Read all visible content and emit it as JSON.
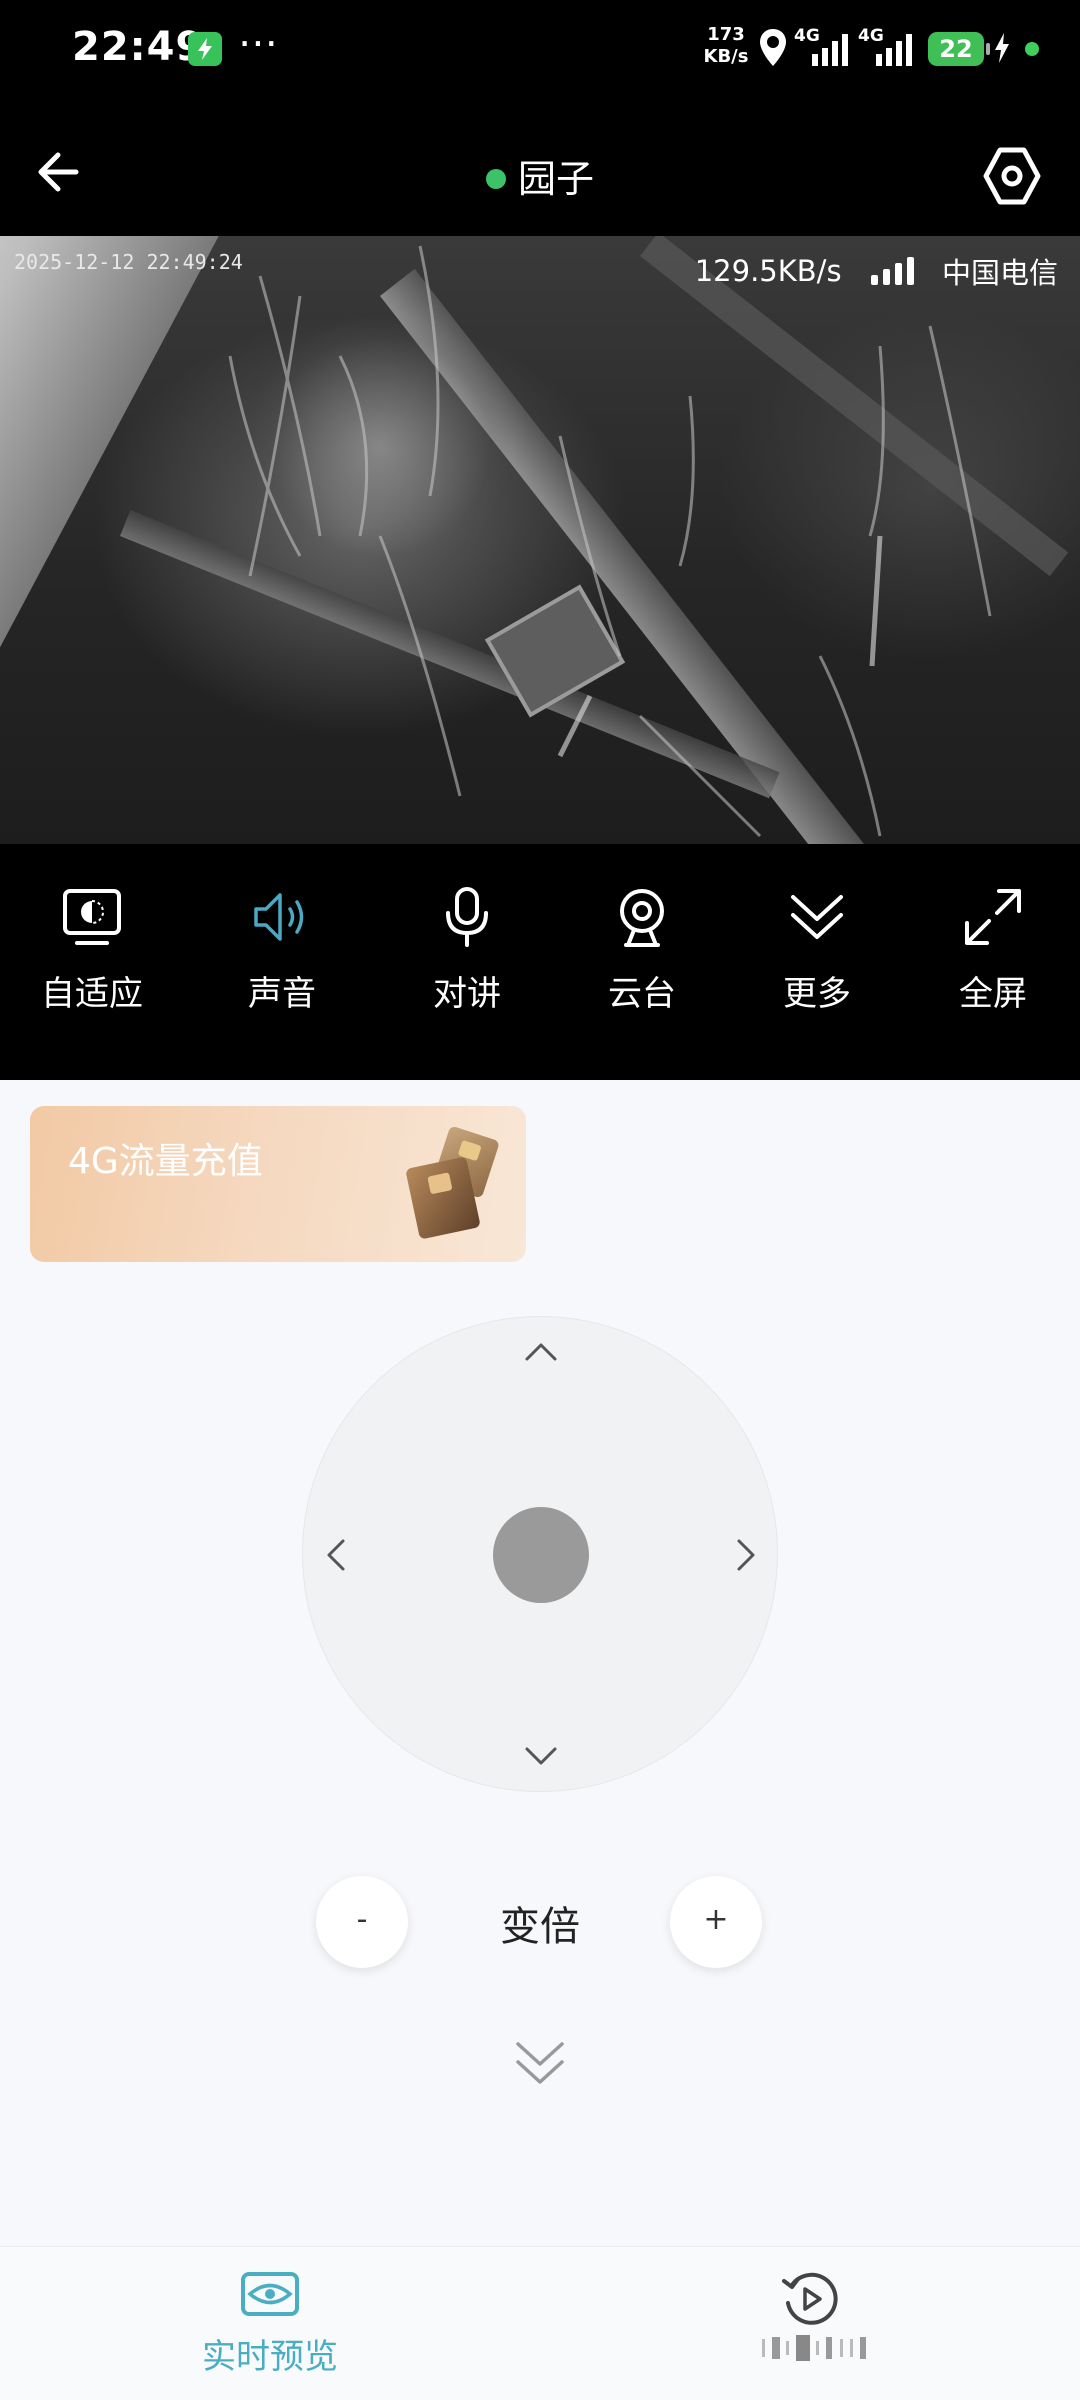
{
  "status_bar": {
    "time": "22:49",
    "net_speed_value": "173",
    "net_speed_unit": "KB/s",
    "network_1": "4G",
    "network_2": "4G",
    "battery": "22",
    "icons": [
      "charging-notification-icon",
      "more-dots-icon",
      "location-icon",
      "signal-icon",
      "battery-icon",
      "charging-icon"
    ]
  },
  "header": {
    "title": "园子",
    "status_color": "#3cc36a",
    "icons": [
      "back-arrow-icon",
      "settings-hex-icon"
    ]
  },
  "video": {
    "timestamp": "2025-12-12 22:49:24",
    "bitrate": "129.5KB/s",
    "carrier": "中国电信"
  },
  "controls": {
    "items": [
      {
        "label": "自适应",
        "icon": "adaptive-screen-icon"
      },
      {
        "label": "声音",
        "icon": "speaker-icon",
        "active": true
      },
      {
        "label": "对讲",
        "icon": "microphone-icon"
      },
      {
        "label": "云台",
        "icon": "ptz-camera-icon"
      },
      {
        "label": "更多",
        "icon": "double-chevron-down-icon"
      },
      {
        "label": "全屏",
        "icon": "fullscreen-icon"
      }
    ],
    "active_color": "#4aa9c4"
  },
  "promo": {
    "label": "4G流量充值"
  },
  "ptz": {
    "arrows": [
      "up",
      "down",
      "left",
      "right"
    ]
  },
  "zoom": {
    "label": "变倍",
    "minus": "-",
    "plus": "+"
  },
  "bottom_nav": {
    "tabs": [
      {
        "label": "实时预览",
        "icon": "eye-preview-icon",
        "active": true
      },
      {
        "label": "",
        "icon": "replay-icon",
        "active": false
      }
    ],
    "active_color": "#49aec2"
  }
}
